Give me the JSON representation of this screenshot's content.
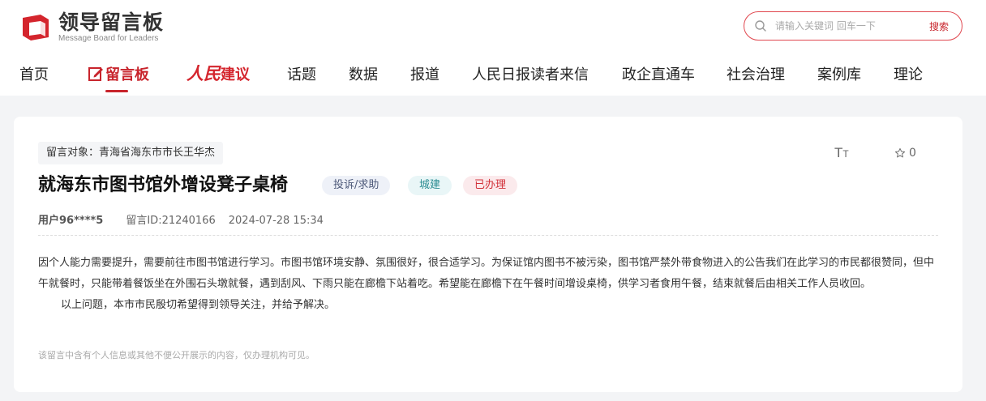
{
  "logo": {
    "title": "领导留言板",
    "subtitle": "Message Board for Leaders",
    "brand_color": "#d4252d"
  },
  "search": {
    "placeholder": "请输入关键词 回车一下",
    "button_label": "搜索"
  },
  "nav": {
    "items": [
      {
        "label": "首页"
      },
      {
        "label": "留言板",
        "active": true
      },
      {
        "label_brand": "人民",
        "label": "建议"
      },
      {
        "label": "话题"
      },
      {
        "label": "数据"
      },
      {
        "label": "报道"
      },
      {
        "label": "人民日报读者来信"
      },
      {
        "label": "政企直通车"
      },
      {
        "label": "社会治理"
      },
      {
        "label": "案例库"
      },
      {
        "label": "理论"
      }
    ]
  },
  "message": {
    "target": "留言对象：青海省海东市市长王华杰",
    "title": "就海东市图书馆外增设凳子桌椅",
    "tags": {
      "type": "投诉/求助",
      "category": "城建",
      "status": "已办理"
    },
    "font_toggle": {
      "big": "T",
      "small": "T"
    },
    "favorite_count": "0",
    "user": "用户96****5",
    "message_id": "留言ID:21240166",
    "date": "2024-07-28 15:34",
    "body": [
      "因个人能力需要提升，需要前往市图书馆进行学习。市图书馆环境安静、氛围很好，很合适学习。为保证馆内图书不被污染，图书馆严禁外带食物进入的公告我们在此学习的市民都很赞同，但中午就餐时，只能带着餐饭坐在外围石头墩就餐，遇到刮风、下雨只能在廊檐下站着吃。希望能在廊檐下在午餐时间增设桌椅，供学习者食用午餐，结束就餐后由相关工作人员收回。",
      "以上问题，本市市民殷切希望得到领导关注，并给予解决。"
    ],
    "privacy_note": "该留言中含有个人信息或其他不便公开展示的内容，仅办理机构可见。"
  }
}
